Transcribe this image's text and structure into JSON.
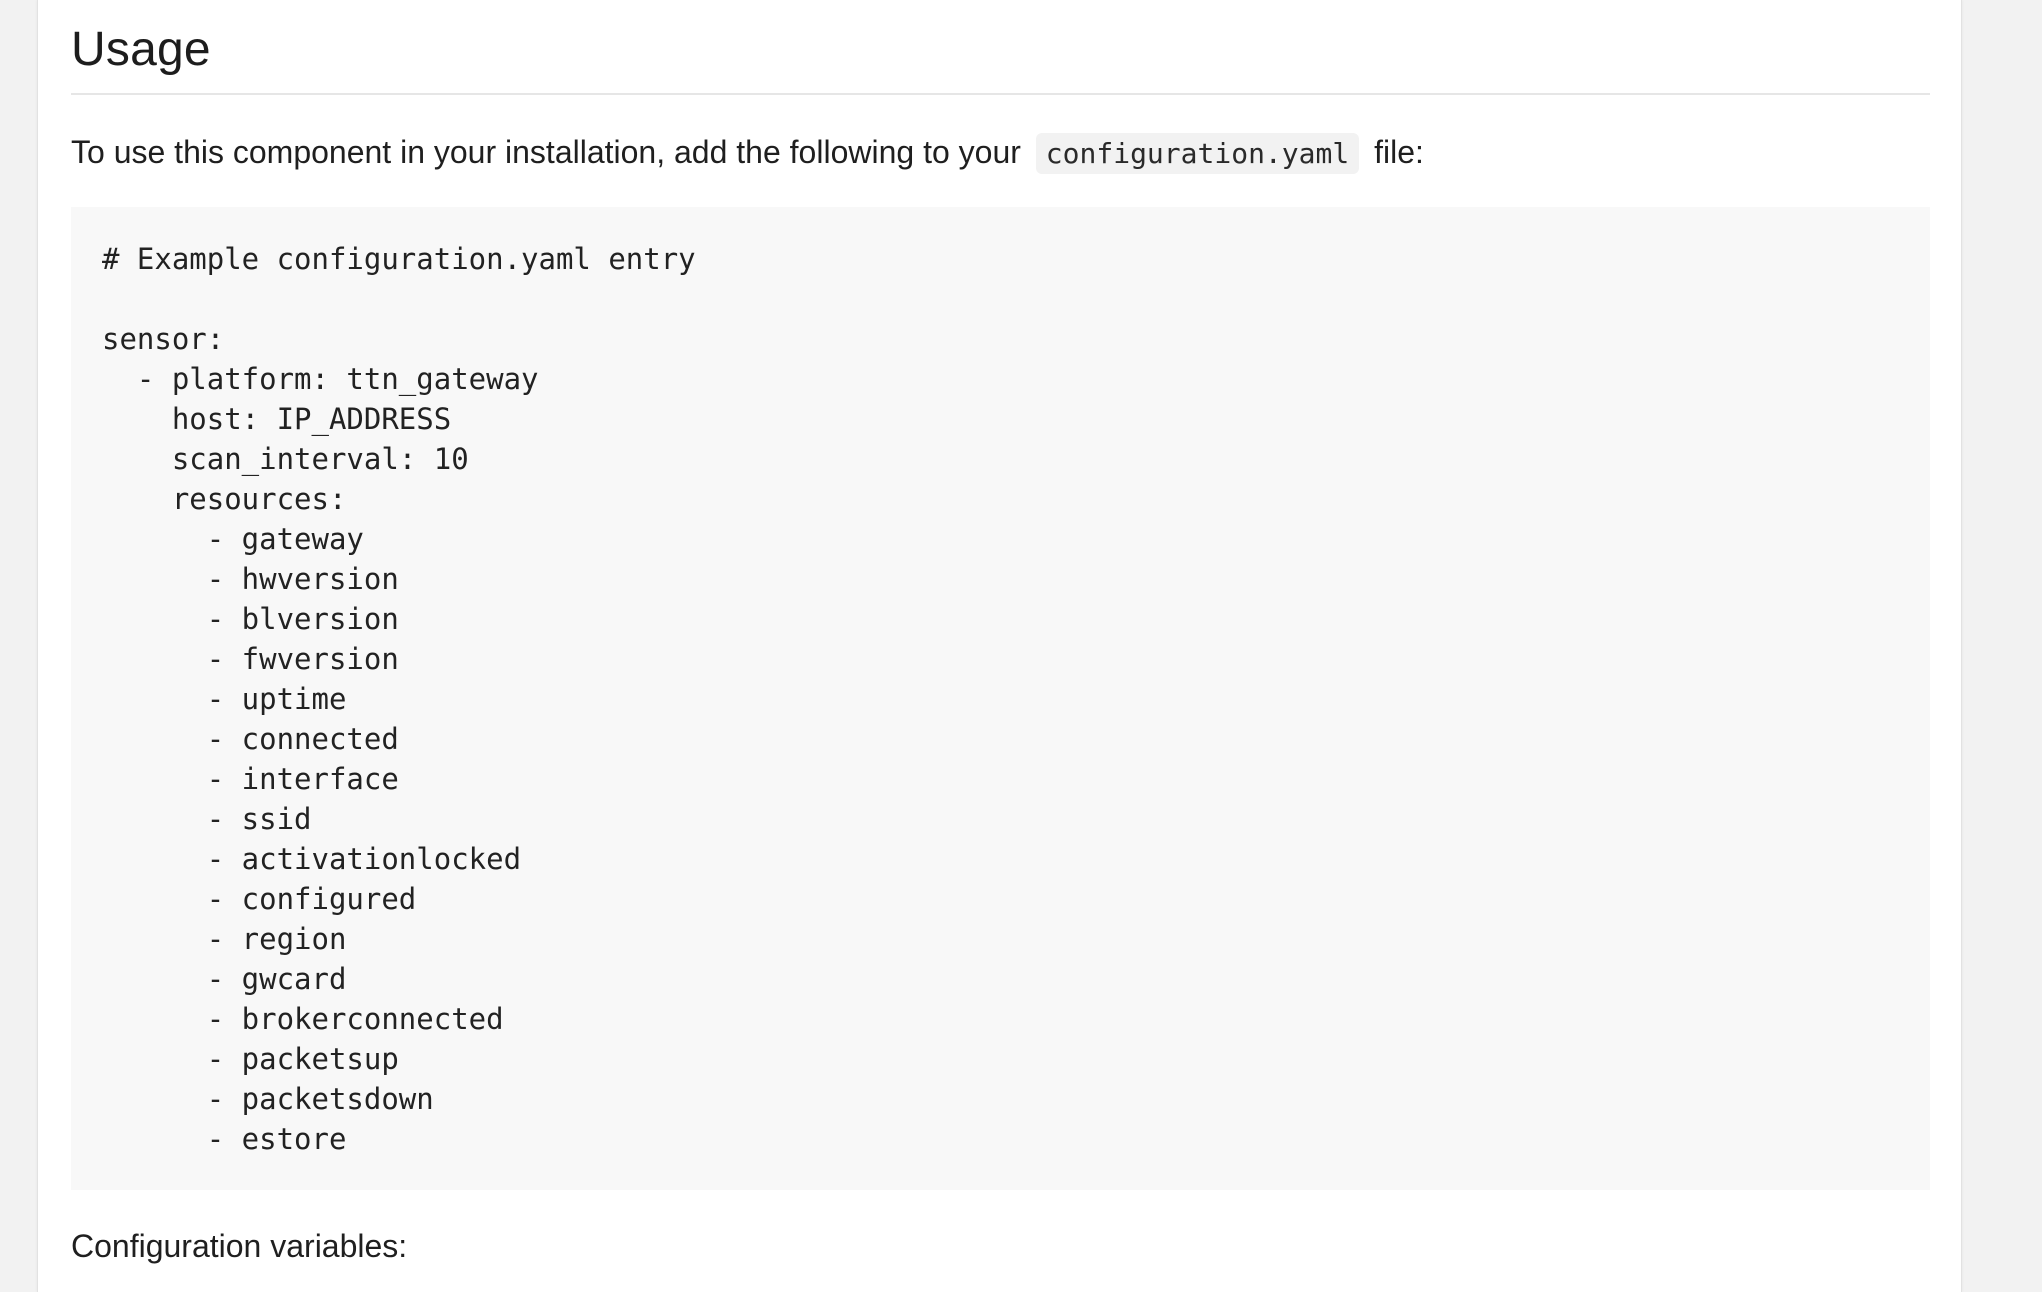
{
  "section": {
    "heading": "Usage"
  },
  "intro": {
    "before": "To use this component in your installation, add the following to your",
    "code": "configuration.yaml",
    "after": "file:"
  },
  "code_block": {
    "lines": [
      "# Example configuration.yaml entry",
      "",
      "sensor:",
      "  - platform: ttn_gateway",
      "    host: IP_ADDRESS",
      "    scan_interval: 10",
      "    resources:",
      "      - gateway",
      "      - hwversion",
      "      - blversion",
      "      - fwversion",
      "      - uptime",
      "      - connected",
      "      - interface",
      "      - ssid",
      "      - activationlocked",
      "      - configured",
      "      - region",
      "      - gwcard",
      "      - brokerconnected",
      "      - packetsup",
      "      - packetsdown",
      "      - estore"
    ]
  },
  "config_vars": {
    "label": "Configuration variables:"
  }
}
